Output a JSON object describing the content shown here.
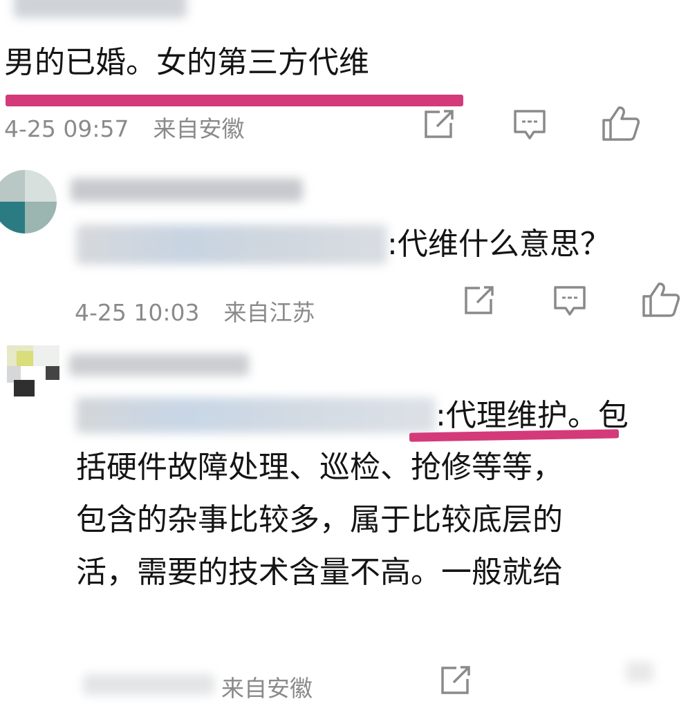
{
  "comment1": {
    "text": "男的已婚。女的第三方代维",
    "time": "4-25 09:57",
    "location": "来自安徽"
  },
  "comment2": {
    "reply_text": ":代维什么意思？",
    "time": "4-25 10:03",
    "location": "来自江苏"
  },
  "comment3": {
    "lines": [
      ":代理维护。包",
      "括硬件故障处理、巡检、抢修等等，",
      "包含的杂事比较多，属于比较底层的",
      "活，需要的技术含量不高。一般就给"
    ],
    "location": "来自安徽"
  },
  "colors": {
    "underline": "#d43a7a",
    "meta": "#8a8a8a",
    "text": "#141414"
  },
  "icons": [
    "share-icon",
    "comment-icon",
    "like-icon"
  ]
}
